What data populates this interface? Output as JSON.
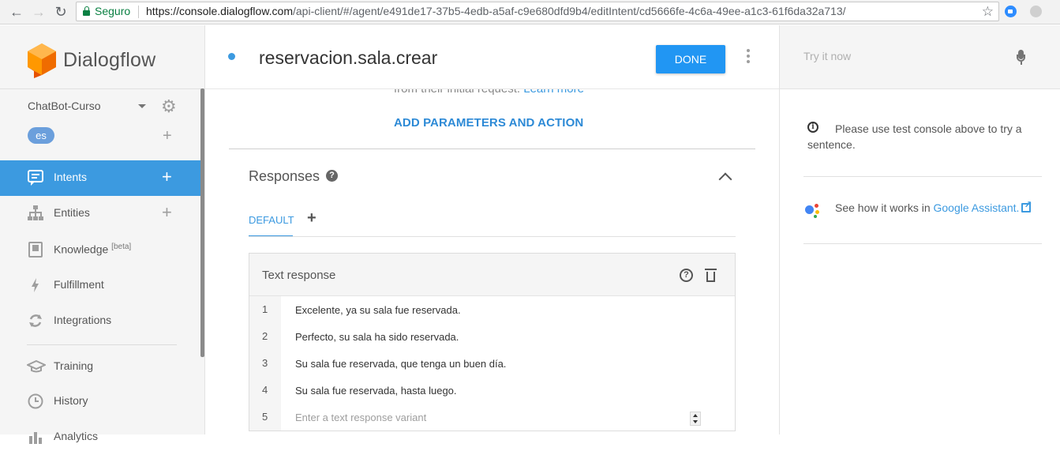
{
  "browser": {
    "secure_label": "Seguro",
    "url_scheme_host": "https://console.dialogflow.com",
    "url_path": "/api-client/#/agent/e491de17-37b5-4edb-a5af-c9e680dfd9b4/editIntent/cd5666fe-4c6a-49ee-a1c3-61f6da32a713/"
  },
  "sidebar": {
    "logo_text": "Dialogflow",
    "agent_name": "ChatBot-Curso",
    "language": "es",
    "items": [
      {
        "label": "Intents",
        "icon": "chat-bubble-icon",
        "active": true
      },
      {
        "label": "Entities",
        "icon": "hierarchy-icon",
        "active": false
      },
      {
        "label": "Knowledge",
        "badge": "[beta]",
        "icon": "book-icon",
        "active": false
      },
      {
        "label": "Fulfillment",
        "icon": "lightning-icon",
        "active": false
      },
      {
        "label": "Integrations",
        "icon": "sync-icon",
        "active": false
      },
      {
        "label": "Training",
        "icon": "graduation-cap-icon",
        "active": false
      },
      {
        "label": "History",
        "icon": "clock-icon",
        "active": false
      },
      {
        "label": "Analytics",
        "icon": "chart-icon",
        "active": false
      }
    ]
  },
  "header": {
    "intent_name": "reservacion.sala.crear",
    "done_label": "DONE"
  },
  "main": {
    "cut_text": "from their initial request.",
    "learn_more": "Learn more",
    "add_params_label": "ADD PARAMETERS AND ACTION",
    "responses_title": "Responses",
    "tab_default": "DEFAULT",
    "card_title": "Text response",
    "responses": [
      {
        "num": "1",
        "text": "Excelente, ya su sala fue reservada."
      },
      {
        "num": "2",
        "text": "Perfecto, su sala ha sido reservada."
      },
      {
        "num": "3",
        "text": "Su sala fue reservada, que tenga un buen día."
      },
      {
        "num": "4",
        "text": "Su sala fue reservada, hasta luego."
      }
    ],
    "new_row_num": "5",
    "new_row_placeholder": "Enter a text response variant"
  },
  "console": {
    "try_placeholder": "Try it now",
    "info_text": "Please use test console above to try a sentence.",
    "ga_prefix": "See how it works in",
    "ga_link": "Google Assistant."
  },
  "colors": {
    "accent": "#3c9ae0",
    "done_button": "#2196f3",
    "secure_green": "#0b8043"
  }
}
